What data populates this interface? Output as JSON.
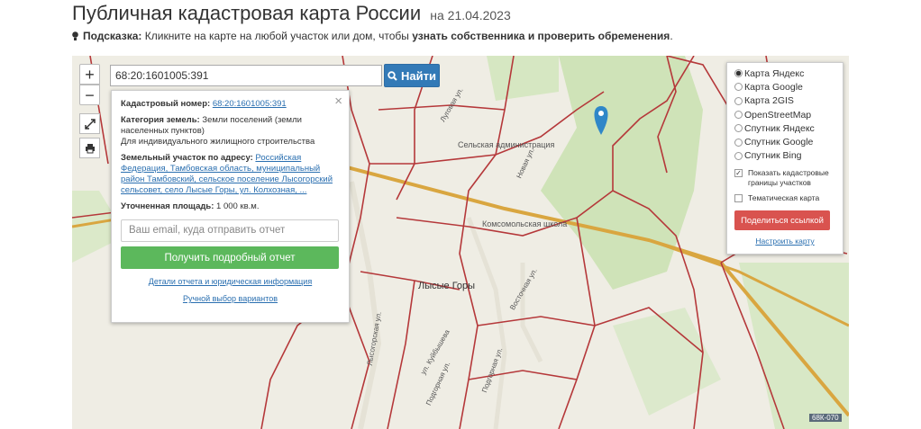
{
  "header": {
    "title": "Публичная кадастровая карта России",
    "date": "на 21.04.2023"
  },
  "hint": {
    "label": "Подсказка:",
    "text": "Кликните на карте на любой участок или дом, чтобы",
    "bold": "узнать собственника и проверить обременения",
    "end": "."
  },
  "controls": {
    "zoom_in": "+",
    "zoom_out": "−"
  },
  "search": {
    "value": "68:20:1601005:391",
    "button": "Найти"
  },
  "popup": {
    "close": "×",
    "cadastral_label": "Кадастровый номер:",
    "cadastral_value": "68:20:1601005:391",
    "category_label": "Категория земель:",
    "category_value": "Земли поселений (земли населенных пунктов)",
    "usage": "Для индивидуального жилищного строительства",
    "address_label": "Земельный участок по адресу:",
    "address_value": "Российская Федерация, Тамбовская область, муниципальный район Тамбовский, сельское поселение Лысогорский сельсовет, село Лысые Горы, ул. Колхозная, ...",
    "area_label": "Уточненная площадь:",
    "area_value": "1 000 кв.м.",
    "email_placeholder": "Ваш email, куда отправить отчет",
    "report_button": "Получить подробный отчет",
    "details_link": "Детали отчета и юридическая информация",
    "manual_link": "Ручной выбор вариантов"
  },
  "layers": {
    "options": [
      {
        "label": "Карта Яндекс",
        "selected": true
      },
      {
        "label": "Карта Google",
        "selected": false
      },
      {
        "label": "Карта 2GIS",
        "selected": false
      },
      {
        "label": "OpenStreetMap",
        "selected": false
      },
      {
        "label": "Спутник Яндекс",
        "selected": false
      },
      {
        "label": "Спутник Google",
        "selected": false
      },
      {
        "label": "Спутник Bing",
        "selected": false
      }
    ],
    "show_boundaries": "Показать кадастровые границы участков",
    "thematic": "Тематическая карта",
    "share_button": "Поделиться ссылкой",
    "setup_link": "Настроить карту"
  },
  "map_labels": {
    "village": "Лысые Горы",
    "admin": "Сельская администрация",
    "school": "Комсомольская школа",
    "street1": "Луговая ул.",
    "street2": "Новая ул.",
    "street3": "Восточная ул.",
    "street4": "Лысогорская ул.",
    "street5": "ул. Куйбышева",
    "street6": "Подгорная ул.",
    "street7": "Подгорная ул.",
    "road": "68К-070"
  },
  "colors": {
    "accent": "#337ab7",
    "report": "#5cb85c",
    "share": "#d9534f",
    "boundary": "#b5383a"
  }
}
